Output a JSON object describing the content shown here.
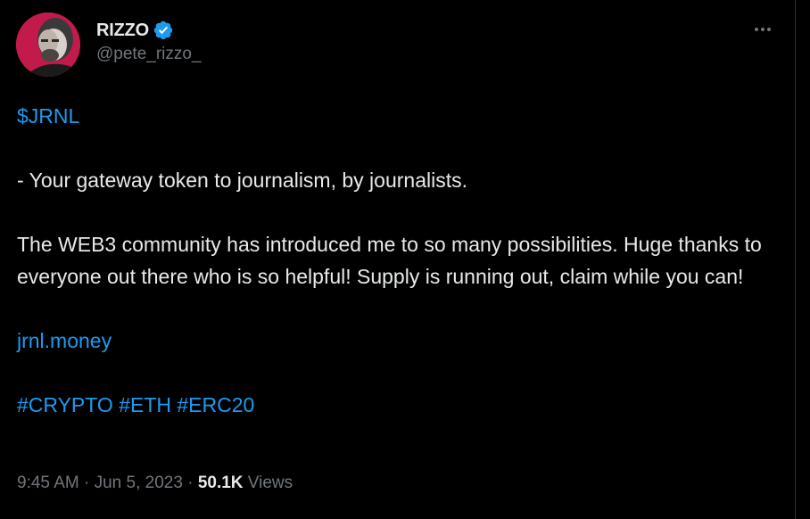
{
  "author": {
    "display_name": "RIZZO",
    "handle": "@pete_rizzo_",
    "verified": true,
    "avatar_bg": "#c21b4b"
  },
  "more_menu": "more-options",
  "tweet": {
    "cashtag": "$JRNL",
    "line1": "- Your gateway token to journalism, by journalists.",
    "paragraph2": "The WEB3 community has introduced me to so many possibilities. Huge thanks to everyone out there who is so helpful!  Supply is running out, claim while you can!",
    "link": "jrnl.money",
    "hashtags": [
      "#CRYPTO",
      "#ETH",
      "#ERC20"
    ]
  },
  "meta": {
    "time": "9:45 AM",
    "separator1": " · ",
    "date": "Jun 5, 2023",
    "separator2": " · ",
    "views_count": "50.1K",
    "views_label": " Views"
  },
  "colors": {
    "background": "#000000",
    "text": "#e7e9ea",
    "muted": "#71767b",
    "link": "#1d9bf0",
    "verified_badge": "#1d9bf0"
  }
}
